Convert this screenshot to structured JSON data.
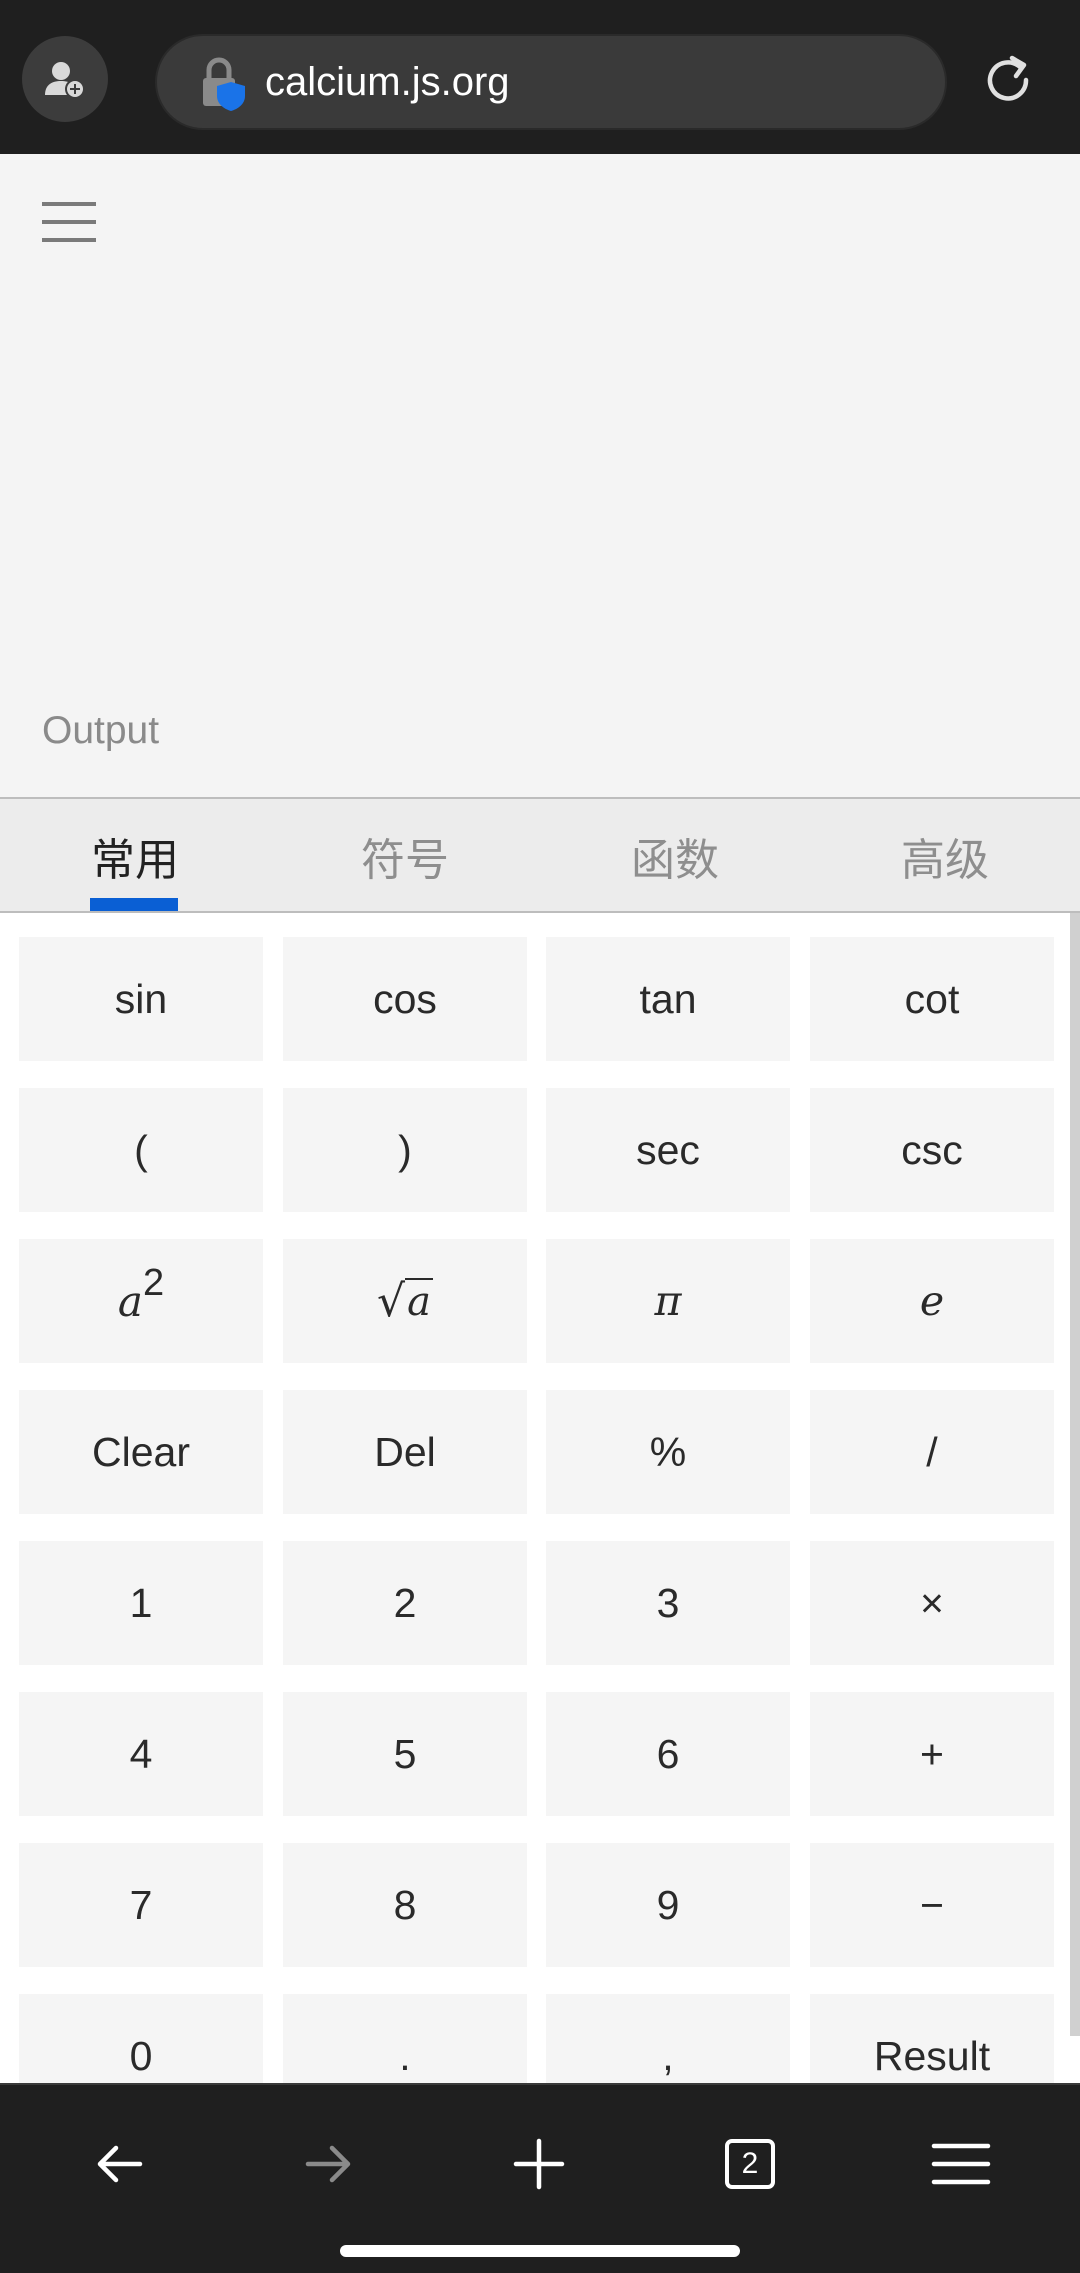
{
  "browser": {
    "url": "calcium.js.org",
    "tab_count": "2"
  },
  "page": {
    "output_label": "Output"
  },
  "tabs": [
    {
      "label": "常用"
    },
    {
      "label": "符号"
    },
    {
      "label": "函数"
    },
    {
      "label": "高级"
    }
  ],
  "keys": {
    "sin": "sin",
    "cos": "cos",
    "tan": "tan",
    "cot": "cot",
    "lparen": "(",
    "rparen": ")",
    "sec": "sec",
    "csc": "csc",
    "a_base": "a",
    "a_exp": "2",
    "sqrt_arg": "a",
    "pi": "π",
    "e": "e",
    "clear": "Clear",
    "del": "Del",
    "percent": "%",
    "divide": "/",
    "one": "1",
    "two": "2",
    "three": "3",
    "multiply": "×",
    "four": "4",
    "five": "5",
    "six": "6",
    "plus": "+",
    "seven": "7",
    "eight": "8",
    "nine": "9",
    "minus": "−",
    "zero": "0",
    "dot": ".",
    "comma": ",",
    "result": "Result"
  },
  "colors": {
    "accent": "#0a5fd4",
    "toolbar": "#1f1f1f",
    "key_bg": "#f5f5f5"
  }
}
